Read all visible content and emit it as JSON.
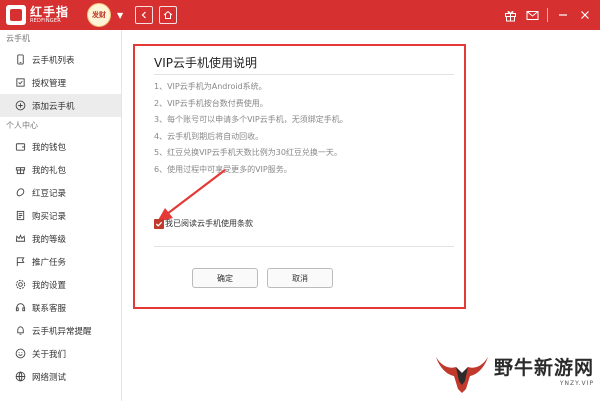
{
  "header": {
    "logo_text": "红手指",
    "logo_sub": "REDFINGER",
    "avatar_text": "发财"
  },
  "sidebar": {
    "section1": "云手机",
    "items1": [
      {
        "label": "云手机列表",
        "icon": "phone-icon"
      },
      {
        "label": "授权管理",
        "icon": "key-icon"
      },
      {
        "label": "添加云手机",
        "icon": "plus-circle-icon"
      }
    ],
    "section2": "个人中心",
    "items2": [
      {
        "label": "我的钱包",
        "icon": "wallet-icon"
      },
      {
        "label": "我的礼包",
        "icon": "gift-icon"
      },
      {
        "label": "红豆记录",
        "icon": "bean-icon"
      },
      {
        "label": "购买记录",
        "icon": "receipt-icon"
      },
      {
        "label": "我的等级",
        "icon": "crown-icon"
      },
      {
        "label": "推广任务",
        "icon": "flag-icon"
      },
      {
        "label": "我的设置",
        "icon": "gear-icon"
      },
      {
        "label": "联系客服",
        "icon": "headset-icon"
      },
      {
        "label": "云手机异常提醒",
        "icon": "bell-icon"
      },
      {
        "label": "关于我们",
        "icon": "smile-icon"
      },
      {
        "label": "网络测试",
        "icon": "network-icon"
      }
    ]
  },
  "dialog": {
    "title": "VIP云手机使用说明",
    "rules": [
      "1、VIP云手机为Android系统。",
      "2、VIP云手机按台数付费使用。",
      "3、每个账号可以申请多个VIP云手机，无须绑定手机。",
      "4、云手机到期后将自动回收。",
      "5、红豆兑换VIP云手机天数比例为30红豆兑换一天。",
      "6、使用过程中可享受更多的VIP服务。"
    ],
    "agree_label": "我已阅读云手机使用条款",
    "ok_label": "确定",
    "cancel_label": "取消"
  },
  "watermark": {
    "text": "野牛新游网",
    "sub": "YNZY.VIP"
  },
  "colors": {
    "brand": "#d63031",
    "highlight": "#e53935"
  }
}
